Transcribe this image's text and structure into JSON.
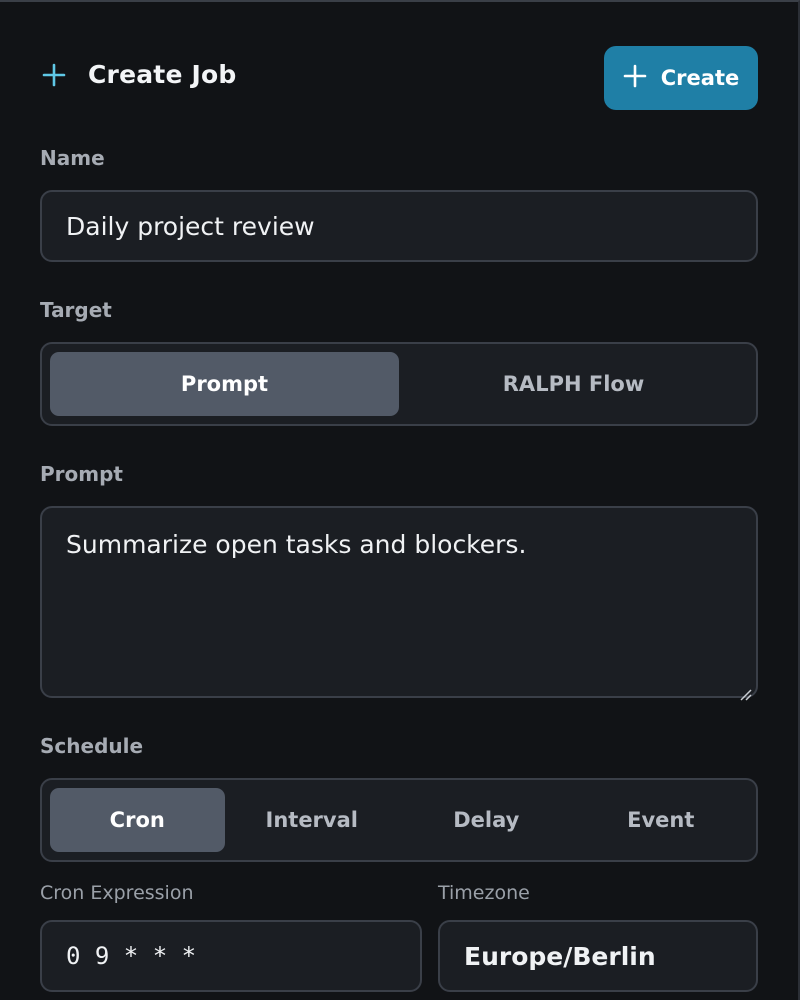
{
  "header": {
    "title": "Create Job",
    "create_button_label": "Create"
  },
  "name": {
    "label": "Name",
    "value": "Daily project review"
  },
  "target": {
    "label": "Target",
    "options": [
      "Prompt",
      "RALPH Flow"
    ],
    "selected": "Prompt"
  },
  "prompt": {
    "label": "Prompt",
    "value": "Summarize open tasks and blockers."
  },
  "schedule": {
    "label": "Schedule",
    "options": [
      "Cron",
      "Interval",
      "Delay",
      "Event"
    ],
    "selected": "Cron"
  },
  "cron": {
    "label": "Cron Expression",
    "value": "0 9 * * *"
  },
  "timezone": {
    "label": "Timezone",
    "value": "Europe/Berlin"
  },
  "colors": {
    "accent": "#1f7fa6",
    "plus_icon": "#5fc8e6",
    "background": "#111316",
    "field_bg": "#1b1e23",
    "active_segment": "#525a67"
  },
  "icons": {
    "header": "plus-icon",
    "create_button": "plus-icon",
    "textarea": "resize-handle-icon"
  }
}
